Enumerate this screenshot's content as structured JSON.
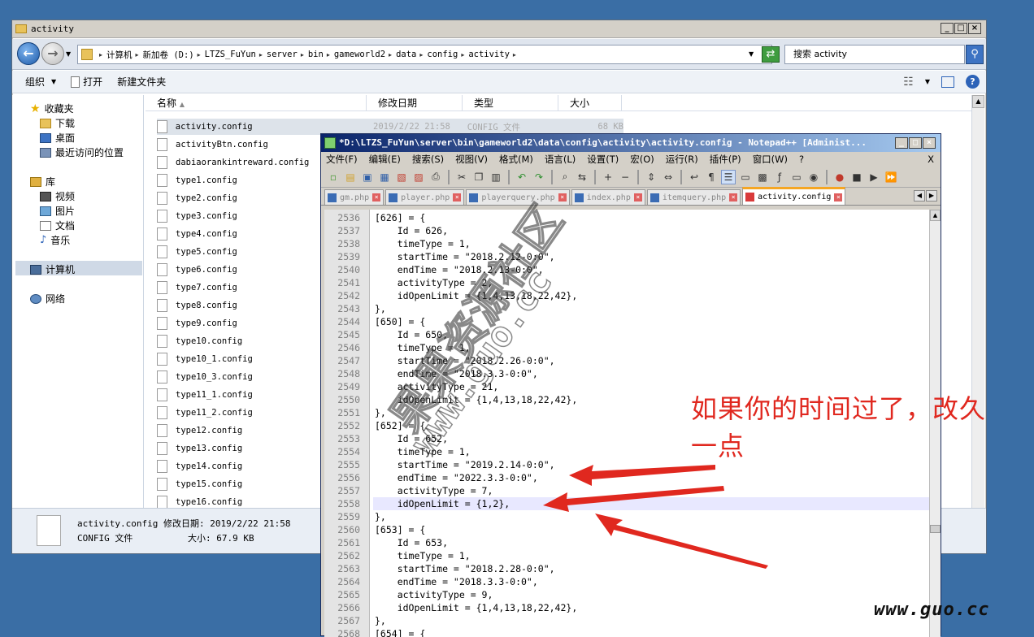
{
  "explorer": {
    "title": "activity",
    "breadcrumbs": [
      "计算机",
      "新加卷 (D:)",
      "LTZS_FuYun",
      "server",
      "bin",
      "gameworld2",
      "data",
      "config",
      "activity"
    ],
    "search_placeholder": "搜索 activity",
    "toolbar": {
      "organize": "组织",
      "open": "打开",
      "new_folder": "新建文件夹"
    },
    "nav": {
      "favorites": "收藏夹",
      "downloads": "下载",
      "desktop": "桌面",
      "recent": "最近访问的位置",
      "libraries": "库",
      "videos": "视频",
      "pictures": "图片",
      "documents": "文档",
      "music": "音乐",
      "computer": "计算机",
      "network": "网络"
    },
    "columns": {
      "name": "名称",
      "date": "修改日期",
      "type": "类型",
      "size": "大小"
    },
    "files": [
      {
        "name": "activity.config",
        "date": "2019/2/22 21:58",
        "type": "CONFIG 文件",
        "size": "68 KB"
      },
      {
        "name": "activityBtn.config"
      },
      {
        "name": "dabiaorankintreward.config"
      },
      {
        "name": "type1.config"
      },
      {
        "name": "type2.config"
      },
      {
        "name": "type3.config"
      },
      {
        "name": "type4.config"
      },
      {
        "name": "type5.config"
      },
      {
        "name": "type6.config"
      },
      {
        "name": "type7.config"
      },
      {
        "name": "type8.config"
      },
      {
        "name": "type9.config"
      },
      {
        "name": "type10.config"
      },
      {
        "name": "type10_1.config"
      },
      {
        "name": "type10_3.config"
      },
      {
        "name": "type11_1.config"
      },
      {
        "name": "type11_2.config"
      },
      {
        "name": "type12.config"
      },
      {
        "name": "type13.config"
      },
      {
        "name": "type14.config"
      },
      {
        "name": "type15.config"
      },
      {
        "name": "type16.config"
      }
    ],
    "details": {
      "line1": "activity.config 修改日期: 2019/2/22 21:58",
      "type": "CONFIG 文件",
      "size": "大小: 67.9 KB"
    }
  },
  "notepad": {
    "title": "*D:\\LTZS_FuYun\\server\\bin\\gameworld2\\data\\config\\activity\\activity.config - Notepad++ [Administ...",
    "menu": [
      "文件(F)",
      "编辑(E)",
      "搜索(S)",
      "视图(V)",
      "格式(M)",
      "语言(L)",
      "设置(T)",
      "宏(O)",
      "运行(R)",
      "插件(P)",
      "窗口(W)",
      "?"
    ],
    "menu_close": "X",
    "tabs": [
      "gm.php",
      "player.php",
      "playerquery.php",
      "index.php",
      "itemquery.php",
      "activity.config"
    ],
    "lines": [
      {
        "n": "2536",
        "t": "[626] = {"
      },
      {
        "n": "2537",
        "t": "    Id = 626,"
      },
      {
        "n": "2538",
        "t": "    timeType = 1,"
      },
      {
        "n": "2539",
        "t": "    startTime = \"2018.2.12-0:0\","
      },
      {
        "n": "2540",
        "t": "    endTime = \"2018.2.13-0:0\","
      },
      {
        "n": "2541",
        "t": "    activityType = 2,"
      },
      {
        "n": "2542",
        "t": "    idOpenLimit = {1,4,13,18,22,42},"
      },
      {
        "n": "2543",
        "t": "},"
      },
      {
        "n": "2544",
        "t": "[650] = {"
      },
      {
        "n": "2545",
        "t": "    Id = 650,"
      },
      {
        "n": "2546",
        "t": "    timeType = 1,"
      },
      {
        "n": "2547",
        "t": "    startTime = \"2018.2.26-0:0\","
      },
      {
        "n": "2548",
        "t": "    endTime = \"2018.3.3-0:0\","
      },
      {
        "n": "2549",
        "t": "    activityType = 21,"
      },
      {
        "n": "2550",
        "t": "    idOpenLimit = {1,4,13,18,22,42},"
      },
      {
        "n": "2551",
        "t": "},"
      },
      {
        "n": "2552",
        "t": "[652] = {"
      },
      {
        "n": "2553",
        "t": "    Id = 652,"
      },
      {
        "n": "2554",
        "t": "    timeType = 1,"
      },
      {
        "n": "2555",
        "t": "    startTime = \"2019.2.14-0:0\","
      },
      {
        "n": "2556",
        "t": "    endTime = \"2022.3.3-0:0\","
      },
      {
        "n": "2557",
        "t": "    activityType = 7,"
      },
      {
        "n": "2558",
        "t": "    idOpenLimit = {1,2},"
      },
      {
        "n": "2559",
        "t": "},"
      },
      {
        "n": "2560",
        "t": "[653] = {"
      },
      {
        "n": "2561",
        "t": "    Id = 653,"
      },
      {
        "n": "2562",
        "t": "    timeType = 1,"
      },
      {
        "n": "2563",
        "t": "    startTime = \"2018.2.28-0:0\","
      },
      {
        "n": "2564",
        "t": "    endTime = \"2018.3.3-0:0\","
      },
      {
        "n": "2565",
        "t": "    activityType = 9,"
      },
      {
        "n": "2566",
        "t": "    idOpenLimit = {1,4,13,18,22,42},"
      },
      {
        "n": "2567",
        "t": "},"
      },
      {
        "n": "2568",
        "t": "[654] = {"
      }
    ],
    "current_line": "2558"
  },
  "annotation": {
    "line1": "如果你的时间过了，改久",
    "line2": "一点",
    "color": "#e0281f"
  },
  "watermark": {
    "cn": "果果资源社区",
    "url": "www.guo.cc"
  },
  "site_mark": "www.guo.cc"
}
